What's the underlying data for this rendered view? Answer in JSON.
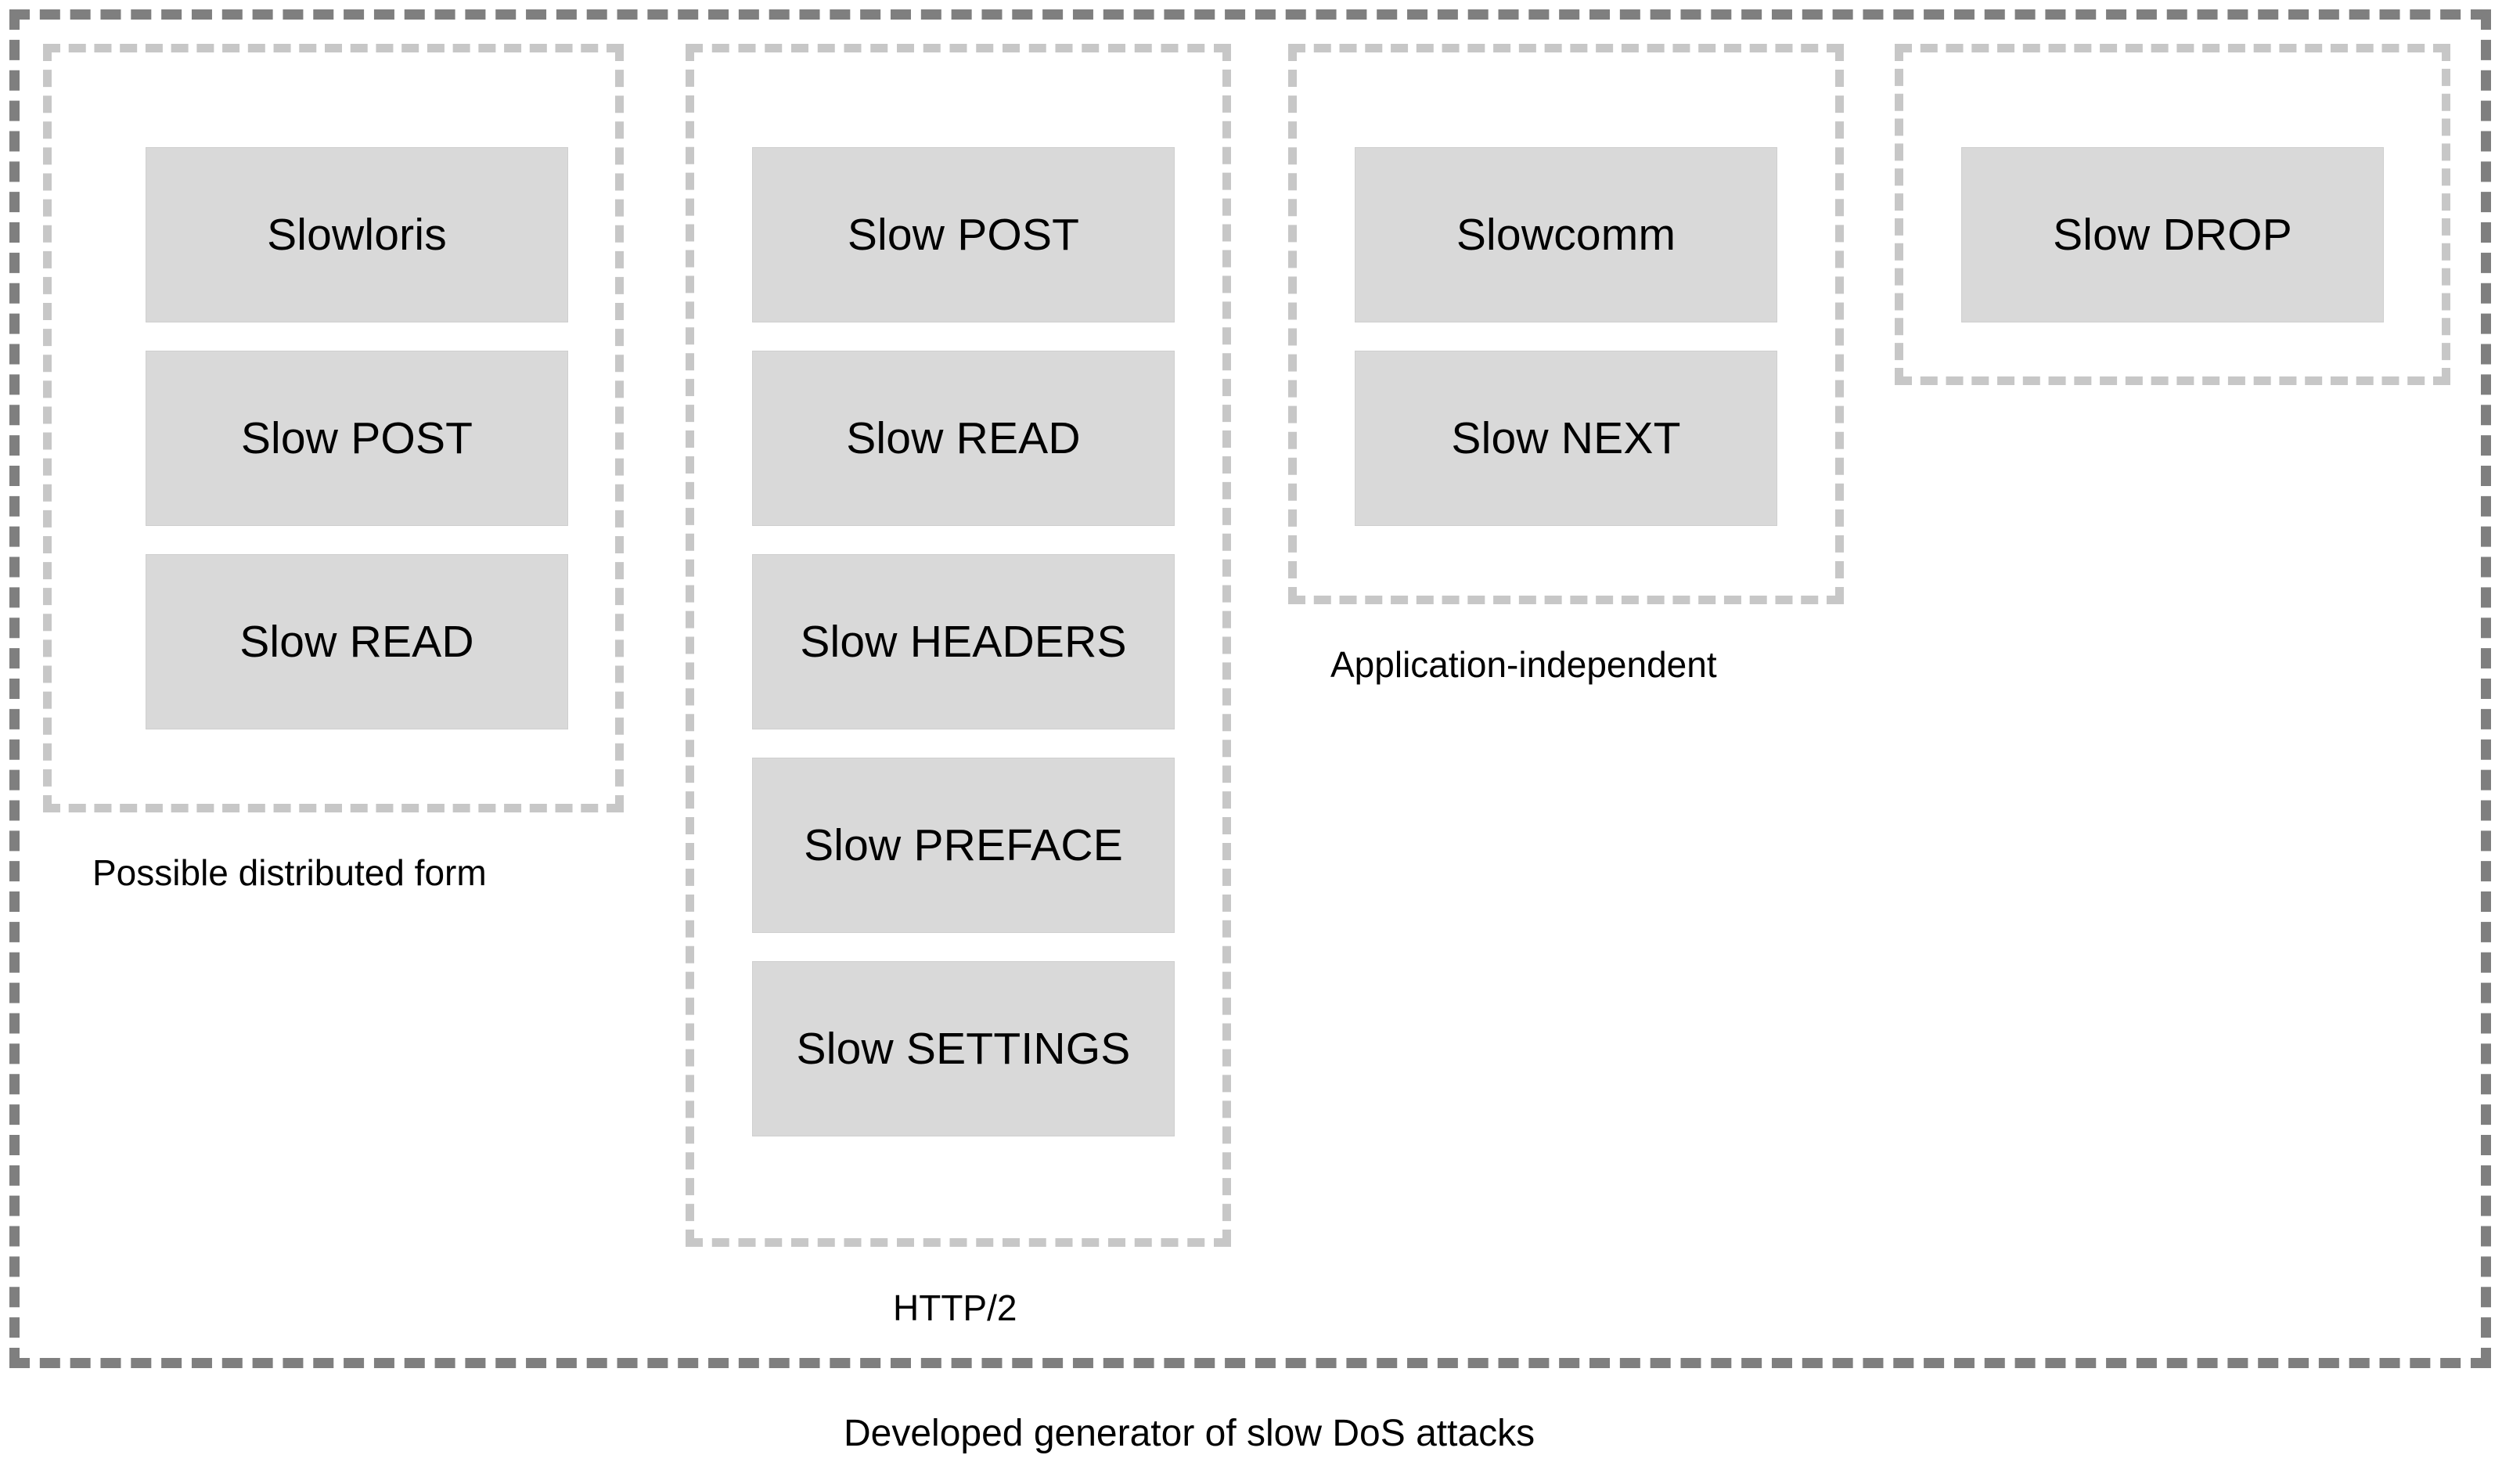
{
  "diagram": {
    "title": "Developed generator of slow DoS attacks",
    "colors": {
      "outer_border": "#7f7f7f",
      "group_border": "#c7c7c7",
      "node_fill": "#d9d9d9",
      "text": "#000000",
      "background": "#ffffff"
    },
    "outer_caption": "Developed generator of slow DoS attacks",
    "groups": [
      {
        "id": "possible-distributed-form",
        "caption": "Possible distributed form",
        "nodes": [
          {
            "label": "Slowloris"
          },
          {
            "label": "Slow POST"
          },
          {
            "label": "Slow READ"
          }
        ]
      },
      {
        "id": "http2",
        "caption": "HTTP/2",
        "nodes": [
          {
            "label": "Slow POST"
          },
          {
            "label": "Slow READ"
          },
          {
            "label": "Slow HEADERS"
          },
          {
            "label": "Slow PREFACE"
          },
          {
            "label": "Slow SETTINGS"
          }
        ]
      },
      {
        "id": "application-independent",
        "caption": "Application-independent",
        "nodes": [
          {
            "label": "Slowcomm"
          },
          {
            "label": "Slow NEXT"
          }
        ]
      },
      {
        "id": "slow-drop-group",
        "caption": "",
        "nodes": [
          {
            "label": "Slow DROP"
          }
        ]
      }
    ]
  }
}
